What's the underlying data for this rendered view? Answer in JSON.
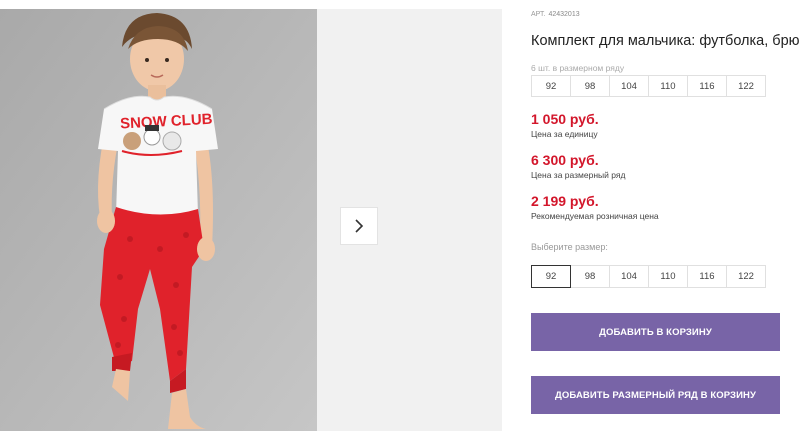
{
  "product": {
    "sku_label": "АРТ.",
    "sku_value": "42432013",
    "title": "Комплект для мальчика: футболка, брюки",
    "pack_label": "6 шт. в размерном ряду",
    "pack_sizes": [
      "92",
      "98",
      "104",
      "110",
      "116",
      "122"
    ]
  },
  "prices": {
    "unit_price": "1 050 руб.",
    "unit_label": "Цена за единицу",
    "pack_price": "6 300 руб.",
    "pack_label": "Цена за размерный ряд",
    "retail_price": "2 199 руб.",
    "retail_label": "Рекомендуемая розничная цена"
  },
  "size_picker": {
    "label": "Выберите размер:",
    "sizes": [
      "92",
      "98",
      "104",
      "110",
      "116",
      "122"
    ],
    "selected": "92"
  },
  "buttons": {
    "add_to_cart": "ДОБАВИТЬ В КОРЗИНУ",
    "add_pack_to_cart": "ДОБАВИТЬ РАЗМЕРНЫЙ РЯД В КОРЗИНУ"
  },
  "gallery": {
    "shirt_print": "SNOW CLUB",
    "arrow_icon": "chevron-right-icon"
  },
  "colors": {
    "price": "#d3162b",
    "button": "#7864a7",
    "pants": "#e0222b"
  }
}
